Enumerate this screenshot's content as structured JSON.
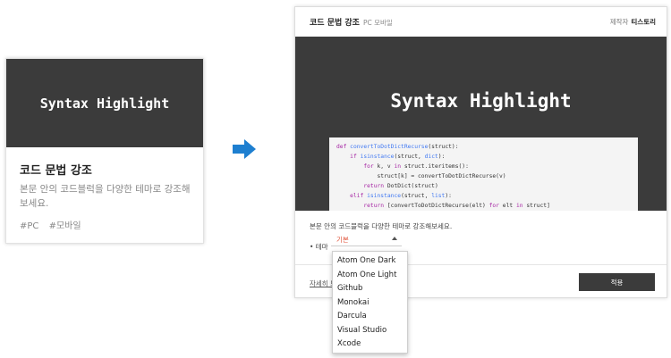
{
  "card": {
    "thumb_text": "Syntax Highlight",
    "title": "코드 문법 강조",
    "description": "본문 안의 코드블럭을 다양한 테마로 강조해보세요.",
    "tags": [
      "#PC",
      "#모바일"
    ]
  },
  "arrow": {
    "icon": "arrow-right-icon",
    "color": "#1e7fd0"
  },
  "window": {
    "title": "코드 문법 강조",
    "subtitle": "PC 모바일",
    "maker_label": "제작자",
    "maker_name": "티스토리",
    "hero_text": "Syntax Highlight",
    "code_lines": [
      "def convertToDotDictRecurse(struct):",
      "    if isinstance(struct, dict):",
      "        for k, v in struct.iteritems():",
      "            struct[k] = convertToDotDictRecurse(v)",
      "        return DotDict(struct)",
      "    elif isinstance(struct, list):",
      "        return [convertToDotDictRecurse(elt) for elt in struct]"
    ],
    "description": "본문 안의 코드블럭을 다양한 테마로 강조해보세요.",
    "theme_label": "• 테마",
    "theme_selected": "기본",
    "more_link": "자세히 보",
    "apply_label": "적용"
  },
  "dropdown": {
    "options": [
      "Atom One Dark",
      "Atom One Light",
      "Github",
      "Monokai",
      "Darcula",
      "Visual Studio",
      "Xcode"
    ]
  }
}
